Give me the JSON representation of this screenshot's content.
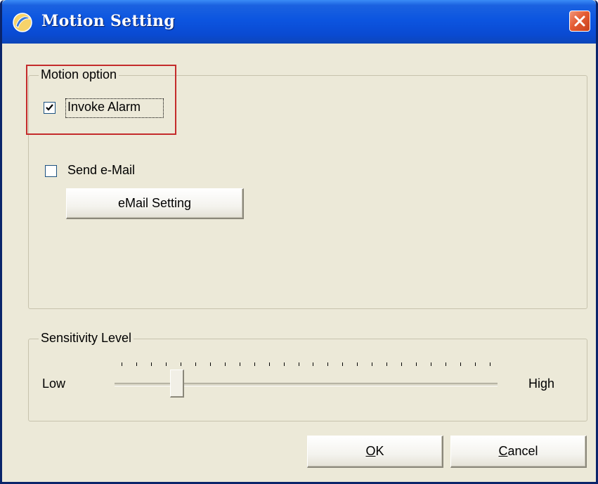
{
  "window": {
    "title": "Motion Setting",
    "close_icon": "close-icon"
  },
  "motion_option": {
    "legend": "Motion option",
    "invoke_alarm": {
      "label": "Invoke Alarm",
      "checked": true
    },
    "send_email": {
      "label": "Send e-Mail",
      "checked": false
    },
    "email_setting_button": "eMail Setting"
  },
  "sensitivity": {
    "legend": "Sensitivity Level",
    "low_label": "Low",
    "high_label": "High",
    "tick_count": 26,
    "level_fraction": 0.15
  },
  "buttons": {
    "ok_mnemonic": "O",
    "ok_rest": "K",
    "cancel_mnemonic": "C",
    "cancel_rest": "ancel"
  },
  "colors": {
    "titlebar": "#0a4ad2",
    "dialog_bg": "#ece9d8",
    "highlight_border": "#c42b2b"
  }
}
